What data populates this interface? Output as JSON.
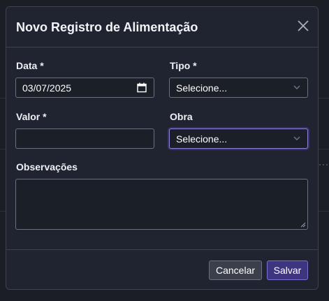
{
  "modal": {
    "title": "Novo Registro de Alimentação"
  },
  "form": {
    "date": {
      "label": "Data *",
      "value": "03/07/2025"
    },
    "type": {
      "label": "Tipo *",
      "selected": "Selecione..."
    },
    "amount": {
      "label": "Valor *",
      "value": ""
    },
    "site": {
      "label": "Obra",
      "selected": "Selecione..."
    },
    "notes": {
      "label": "Observações",
      "value": ""
    }
  },
  "buttons": {
    "cancel": "Cancelar",
    "save": "Salvar"
  },
  "icons": {
    "close": "close-icon",
    "calendar": "calendar-icon",
    "chevron": "chevron-down-icon"
  },
  "colors": {
    "accent": "#3d3580",
    "background": "#1f2430"
  }
}
